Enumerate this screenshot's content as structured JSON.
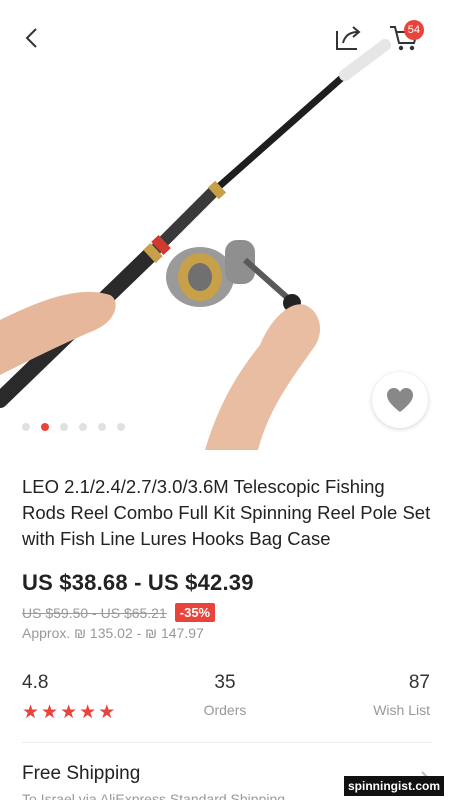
{
  "header": {
    "back_icon": "chevron-left-icon",
    "share_icon": "share-icon",
    "cart_icon": "cart-icon",
    "cart_count": "54"
  },
  "gallery": {
    "image_count": 6,
    "active_index": 1
  },
  "product": {
    "title": "LEO 2.1/2.4/2.7/3.0/3.6M Telescopic Fishing Rods Reel Combo Full Kit Spinning Reel Pole Set with Fish Line Lures Hooks Bag Case",
    "price_range": "US $38.68 - US $42.39",
    "original_price": "US $59.50 - US $65.21",
    "discount": "-35%",
    "approx_price": "Approx. ₪ 135.02 - ₪ 147.97"
  },
  "stats": {
    "rating": "4.8",
    "stars": 5,
    "orders_count": "35",
    "orders_label": "Orders",
    "wishlist_count": "87",
    "wishlist_label": "Wish List"
  },
  "shipping": {
    "title": "Free Shipping",
    "subtitle": "To Israel via AliExpress Standard Shipping"
  },
  "watermark": "spinningist.com",
  "colors": {
    "accent": "#e8443b",
    "text_primary": "#222222",
    "text_secondary": "#999999"
  }
}
